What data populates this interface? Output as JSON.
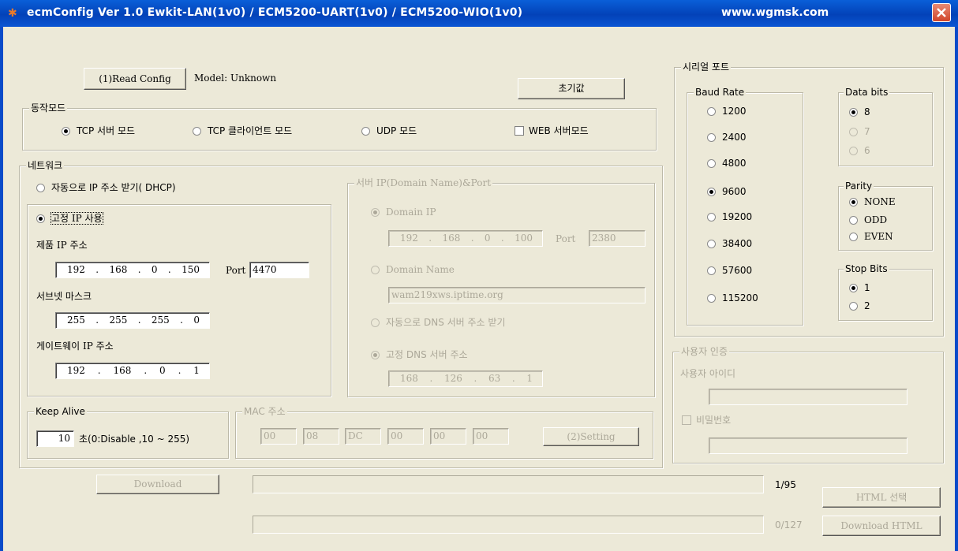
{
  "window": {
    "title": "ecmConfig Ver 1.0  Ewkit-LAN(1v0) / ECM5200-UART(1v0) / ECM5200-WIO(1v0)",
    "url": "www.wgmsk.com"
  },
  "top": {
    "read_config_label": "(1)Read Config",
    "model_text": "Model: Unknown",
    "default_label": "초기값"
  },
  "mode": {
    "title": "동작모드",
    "tcp_server": "TCP 서버 모드",
    "tcp_client": "TCP 클라이언트 모드",
    "udp": "UDP 모드",
    "web_server": "WEB 서버모드"
  },
  "network": {
    "title": "네트워크",
    "dhcp_label": "자동으로 IP 주소 받기( DHCP)",
    "static_label": "고정 IP 사용",
    "device_ip_label": "제품 IP 주소",
    "device_ip": [
      "192",
      "168",
      "0",
      "150"
    ],
    "port_label": "Port",
    "port_value": "4470",
    "subnet_label": "서브넷 마스크",
    "subnet": [
      "255",
      "255",
      "255",
      "0"
    ],
    "gateway_label": "게이트웨이 IP 주소",
    "gateway": [
      "192",
      "168",
      "0",
      "1"
    ]
  },
  "server": {
    "title": "서버 IP(Domain Name)&Port",
    "domain_ip_label": "Domain IP",
    "domain_ip": [
      "192",
      "168",
      "0",
      "100"
    ],
    "port_label": "Port",
    "port_value": "2380",
    "domain_name_label": "Domain Name",
    "domain_name_value": "wam219xws.iptime.org",
    "auto_dns_label": "자동으로 DNS 서버 주소 받기",
    "static_dns_label": "고정 DNS 서버 주소",
    "dns": [
      "168",
      "126",
      "63",
      "1"
    ]
  },
  "keepalive": {
    "title": "Keep Alive",
    "value": "10",
    "desc": "초(0:Disable ,10 ~ 255)"
  },
  "mac": {
    "title": "MAC 주소",
    "bytes": [
      "00",
      "08",
      "DC",
      "00",
      "00",
      "00"
    ],
    "setting_label": "(2)Setting"
  },
  "serial": {
    "title": "시리얼 포트",
    "baud_title": "Baud Rate",
    "baud_rates": [
      "1200",
      "2400",
      "4800",
      "9600",
      "19200",
      "38400",
      "57600",
      "115200"
    ],
    "data_bits_title": "Data bits",
    "data_bits": [
      "8",
      "7",
      "6"
    ],
    "parity_title": "Parity",
    "parity": [
      "NONE",
      "ODD",
      "EVEN"
    ],
    "stop_bits_title": "Stop Bits",
    "stop_bits": [
      "1",
      "2"
    ]
  },
  "auth": {
    "title": "사용자 인증",
    "user_id_label": "사용자 아이디",
    "password_label": "비밀번호"
  },
  "bottom": {
    "download_label": "Download",
    "progress1_text": "1/95",
    "progress2_text": "0/127",
    "html_select_label": "HTML 선택",
    "download_html_label": "Download HTML"
  }
}
